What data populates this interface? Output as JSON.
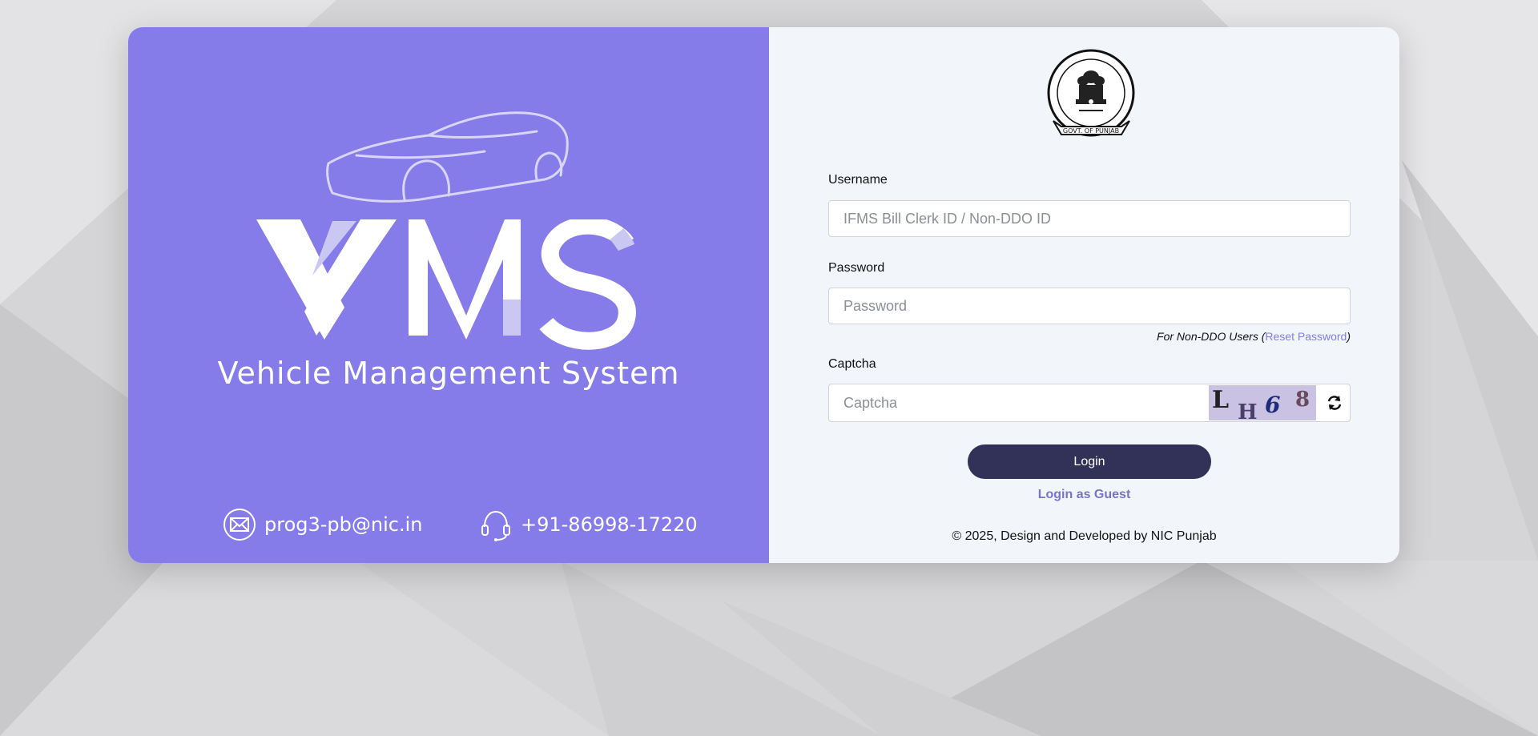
{
  "brand": {
    "logo_text": "VMS",
    "tagline": "Vehicle Management System"
  },
  "contact": {
    "email": "prog3-pb@nic.in",
    "phone": "+91-86998-17220"
  },
  "emblem": {
    "caption": "GOVT. OF PUNJAB"
  },
  "form": {
    "username_label": "Username",
    "username_placeholder": "IFMS Bill Clerk ID / Non-DDO ID",
    "password_label": "Password",
    "password_placeholder": "Password",
    "hint_prefix": "For Non-DDO Users (",
    "hint_link": "Reset Password",
    "hint_suffix": ")",
    "captcha_label": "Captcha",
    "captcha_placeholder": "Captcha",
    "captcha_chars": [
      "L",
      "H",
      "6",
      "8"
    ],
    "login_label": "Login",
    "guest_label": "Login as Guest"
  },
  "footer": "© 2025, Design and Developed by NIC Punjab",
  "colors": {
    "left_panel": "#857be9",
    "right_panel": "#f2f5fa",
    "login_button": "#323157",
    "link": "#857be9"
  },
  "icons": {
    "email": "envelope-icon",
    "phone": "headset-icon",
    "refresh": "refresh-icon"
  }
}
